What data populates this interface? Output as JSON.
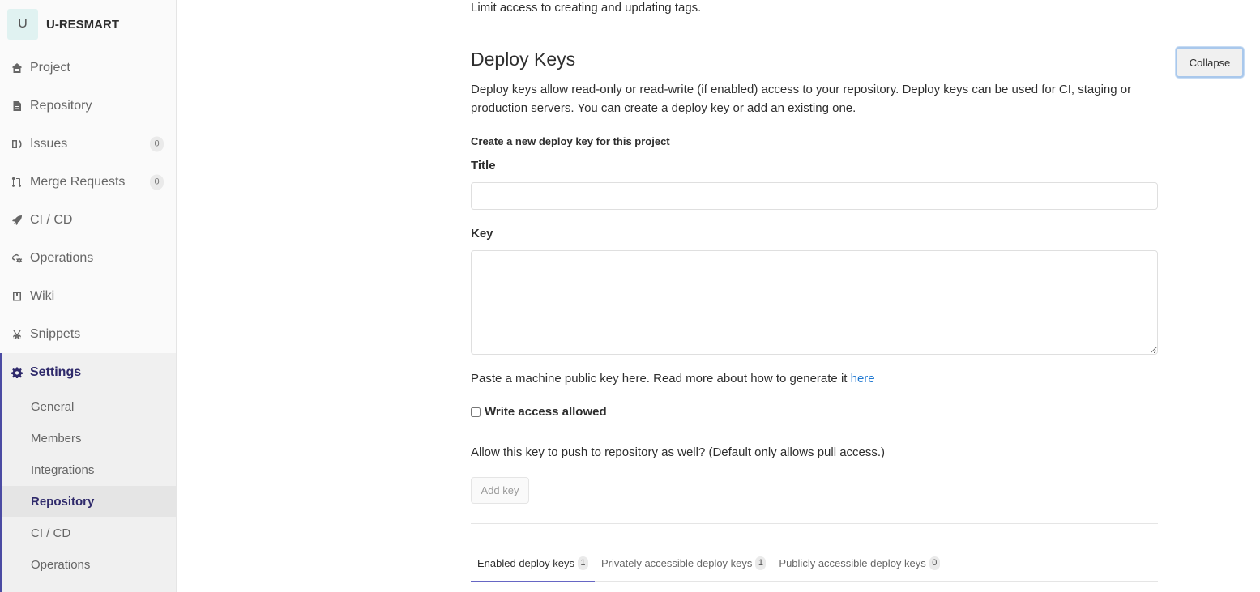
{
  "project": {
    "avatar_letter": "U",
    "name": "U-RESMART"
  },
  "sidebar": {
    "items": [
      {
        "label": "Project",
        "icon": "home-icon"
      },
      {
        "label": "Repository",
        "icon": "doc-icon"
      },
      {
        "label": "Issues",
        "icon": "issues-icon",
        "badge": "0"
      },
      {
        "label": "Merge Requests",
        "icon": "merge-request-icon",
        "badge": "0"
      },
      {
        "label": "CI / CD",
        "icon": "rocket-icon"
      },
      {
        "label": "Operations",
        "icon": "cloud-gear-icon"
      },
      {
        "label": "Wiki",
        "icon": "book-icon"
      },
      {
        "label": "Snippets",
        "icon": "scissors-icon"
      },
      {
        "label": "Settings",
        "icon": "gear-icon",
        "active": true
      }
    ],
    "settings_sub": [
      {
        "label": "General"
      },
      {
        "label": "Members"
      },
      {
        "label": "Integrations"
      },
      {
        "label": "Repository",
        "active": true
      },
      {
        "label": "CI / CD"
      },
      {
        "label": "Operations"
      }
    ]
  },
  "main": {
    "intro_text": "Limit access to creating and updating tags.",
    "section_title": "Deploy Keys",
    "collapse_label": "Collapse",
    "section_desc": "Deploy keys allow read-only or read-write (if enabled) access to your repository. Deploy keys can be used for CI, staging or production servers. You can create a deploy key or add an existing one.",
    "form_heading": "Create a new deploy key for this project",
    "title_label": "Title",
    "title_value": "",
    "key_label": "Key",
    "key_value": "",
    "help_text": "Paste a machine public key here. Read more about how to generate it ",
    "help_link": "here",
    "write_access_label": "Write access allowed",
    "write_access_checked": false,
    "allow_text": "Allow this key to push to repository as well? (Default only allows pull access.)",
    "add_key_label": "Add key",
    "tabs": [
      {
        "label": "Enabled deploy keys",
        "count": "1",
        "active": true
      },
      {
        "label": "Privately accessible deploy keys",
        "count": "1"
      },
      {
        "label": "Publicly accessible deploy keys",
        "count": "0"
      }
    ]
  },
  "colors": {
    "accent": "#4b4ba3",
    "link": "#1f78d1",
    "tab_underline": "#6666c4"
  }
}
